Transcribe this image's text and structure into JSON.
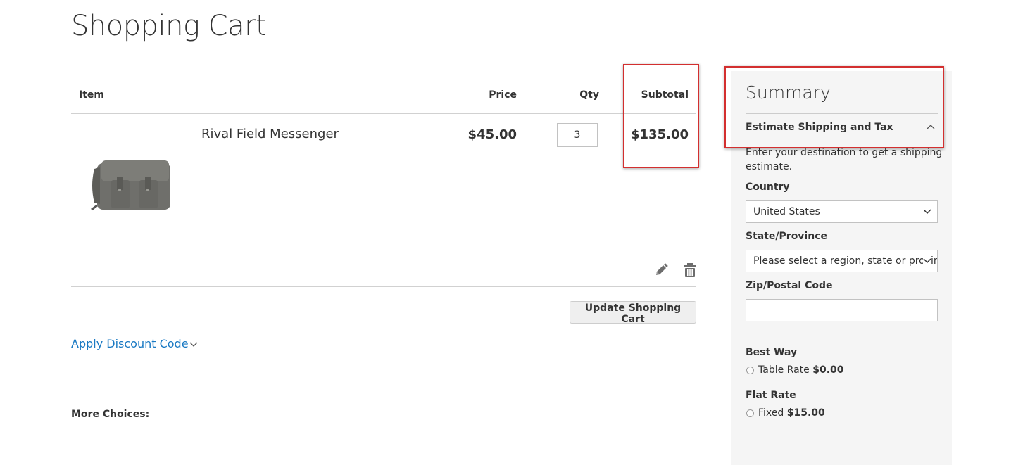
{
  "page": {
    "title": "Shopping Cart"
  },
  "cart_table": {
    "headers": {
      "item": "Item",
      "price": "Price",
      "qty": "Qty",
      "subtotal": "Subtotal"
    },
    "items": [
      {
        "name": "Rival Field Messenger",
        "price": "$45.00",
        "qty": "3",
        "subtotal": "$135.00"
      }
    ]
  },
  "actions": {
    "update_label": "Update Shopping Cart",
    "edit_icon": "pencil-icon",
    "delete_icon": "trash-icon"
  },
  "discount": {
    "label": "Apply Discount Code"
  },
  "more_choices": {
    "label": "More Choices:"
  },
  "summary": {
    "title": "Summary",
    "estimate_label": "Estimate Shipping and Tax",
    "intro": "Enter your destination to get a shipping estimate.",
    "country_label": "Country",
    "country_value": "United States",
    "state_label": "State/Province",
    "state_value": "Please select a region, state or province.",
    "zip_label": "Zip/Postal Code",
    "zip_value": "",
    "shipping": [
      {
        "carrier": "Best Way",
        "method": "Table Rate",
        "price": "$0.00"
      },
      {
        "carrier": "Flat Rate",
        "method": "Fixed",
        "price": "$15.00"
      }
    ]
  },
  "colors": {
    "link": "#1979c3",
    "highlight": "#d32f2f",
    "summary_bg": "#f5f5f5"
  }
}
